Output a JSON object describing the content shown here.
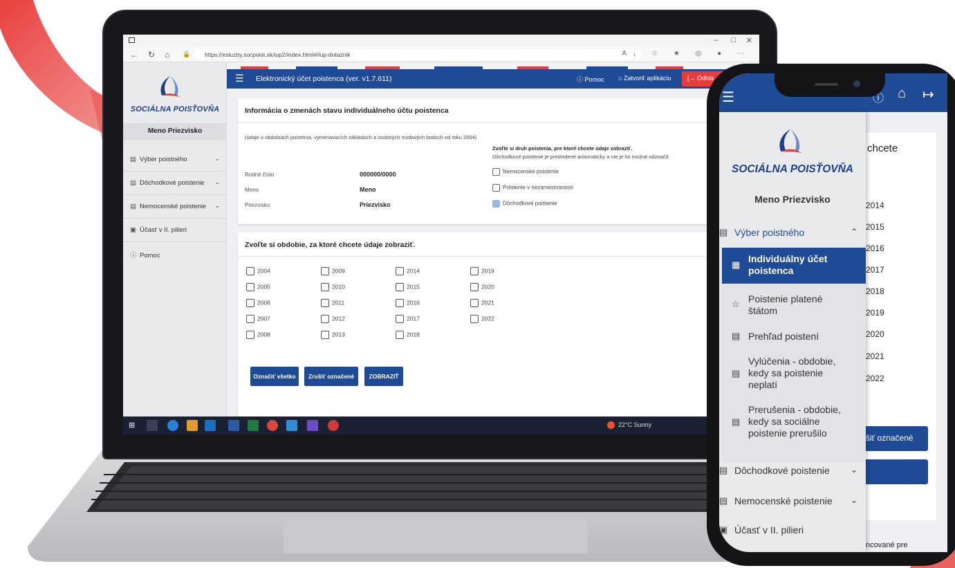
{
  "browser": {
    "url": "https://esluzby.socpoist.sk/iup2/index.html#/iup-dotaznik"
  },
  "app": {
    "title": "Elektronický účet poistenca (ver. v1.7.611)",
    "help_label": "Pomoc",
    "close_label": "Zatvoriť aplikáciu",
    "logout_label": "Odhlá"
  },
  "sidebar": {
    "brand": "SOCIÁLNA POISŤOVŇA",
    "user": "Meno Priezvisko",
    "items": [
      {
        "label": "Výber poistného",
        "icon": "document-icon"
      },
      {
        "label": "Dôchodkové poistenie",
        "icon": "document-icon"
      },
      {
        "label": "Nemocenské poistenie",
        "icon": "document-icon"
      },
      {
        "label": "Účasť v II. pilieri",
        "icon": "folder-icon"
      },
      {
        "label": "Pomoc",
        "icon": "help-icon"
      }
    ]
  },
  "info_card": {
    "title": "Informácia o zmenách stavu individuálneho účtu poistenca",
    "subtitle": "(údaje o obdobiach poistenia, vymeriavacích základoch a osobných mzdových bodoch od roku 2004)",
    "prompt": "Zvoľte si druh poistenia, pre ktoré chcete údaje zobraziť.",
    "note": "Dôchodkové poistenie je predvolené automaticky a nie je ho možné odznačiť.",
    "fields": [
      {
        "label": "Rodné číslo",
        "value": "000000/0000"
      },
      {
        "label": "Meno",
        "value": "Meno"
      },
      {
        "label": "Priezvisko",
        "value": "Priezvisko"
      }
    ],
    "insurance_types": [
      {
        "label": "Nemocenské poistenie",
        "checked": false
      },
      {
        "label": "Poistenie v nezamestnanosti",
        "checked": false
      },
      {
        "label": "Dôchodkové poistenie",
        "checked": true
      }
    ]
  },
  "period_card": {
    "title": "Zvoľte si obdobie, za ktoré chcete údaje zobraziť.",
    "years": [
      "2004",
      "2005",
      "2006",
      "2007",
      "2008",
      "2009",
      "2010",
      "2011",
      "2012",
      "2013",
      "2014",
      "2015",
      "2016",
      "2017",
      "2018",
      "2019",
      "2020",
      "2021",
      "2022"
    ],
    "buttons": {
      "select_all": "Označiť všetko",
      "clear": "Zrušiť označené",
      "show": "ZOBRAZIŤ"
    }
  },
  "taskbar": {
    "weather": "22°C  Sunny"
  },
  "phone": {
    "brand": "SOCIÁLNA POISŤOVŇA",
    "user": "Meno Priezvisko",
    "menu": {
      "top": {
        "label": "Výber poistného"
      },
      "subitems": [
        {
          "label": "Individuálny účet poistenca",
          "active": true
        },
        {
          "label": "Poistenie platené štátom",
          "active": false
        },
        {
          "label": "Prehľad poistení",
          "active": false
        },
        {
          "label": "Vylúčenia - obdobie, kedy sa poistenie neplatí",
          "active": false
        },
        {
          "label": "Prerušenia - obdobie, kedy sa sociálne poistenie prerušilo",
          "active": false
        }
      ],
      "bottom": [
        {
          "label": "Dôchodkové poistenie"
        },
        {
          "label": "Nemocenské poistenie"
        },
        {
          "label": "Účasť v II. pilieri"
        }
      ]
    },
    "behind": {
      "heading_fragment": "chcete",
      "years": [
        "2014",
        "2015",
        "2016",
        "2017",
        "2018",
        "2019",
        "2020",
        "2021",
        "2022"
      ],
      "button_fragment": "šiť označené",
      "footer_fragment": "ncované pre"
    }
  },
  "colors": {
    "primary": "#1f4a96",
    "logout": "#e53b3b",
    "brand": "#1e3f87",
    "accent_arrow": "#e24a4a"
  }
}
